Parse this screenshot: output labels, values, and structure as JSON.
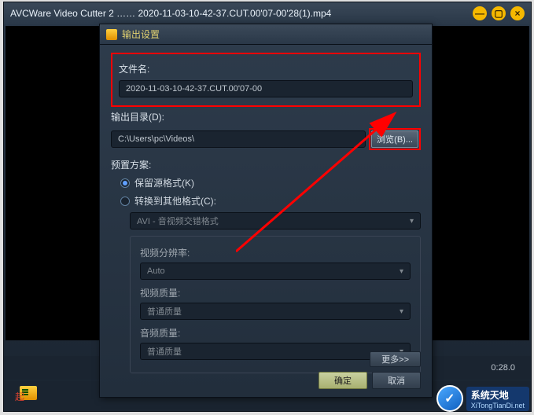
{
  "main": {
    "title": "AVCWare Video Cutter 2 …… 2020-11-03-10-42-37.CUT.00'07-00'28(1).mp4",
    "timecode": "0:28.0",
    "status_prefix": "起"
  },
  "dialog": {
    "title": "输出设置",
    "filename_label": "文件名:",
    "filename_value": "2020-11-03-10-42-37.CUT.00'07-00",
    "outdir_label": "输出目录(D):",
    "outdir_value": "C:\\Users\\pc\\Videos\\",
    "browse_label": "浏览(B)...",
    "preset_label": "预置方案:",
    "radio_keep": "保留源格式(K)",
    "radio_convert": "转换到其他格式(C):",
    "format_value": "AVI - 音视频交错格式",
    "res_label": "视频分辨率:",
    "res_value": "Auto",
    "vq_label": "视频质量:",
    "vq_value": "普通质量",
    "aq_label": "音频质量:",
    "aq_value": "普通质量",
    "more_label": "更多>>",
    "ok_label": "确定",
    "cancel_label": "取消"
  },
  "watermark": {
    "brand": "系统天地",
    "url": "XiTongTianDi.net"
  }
}
